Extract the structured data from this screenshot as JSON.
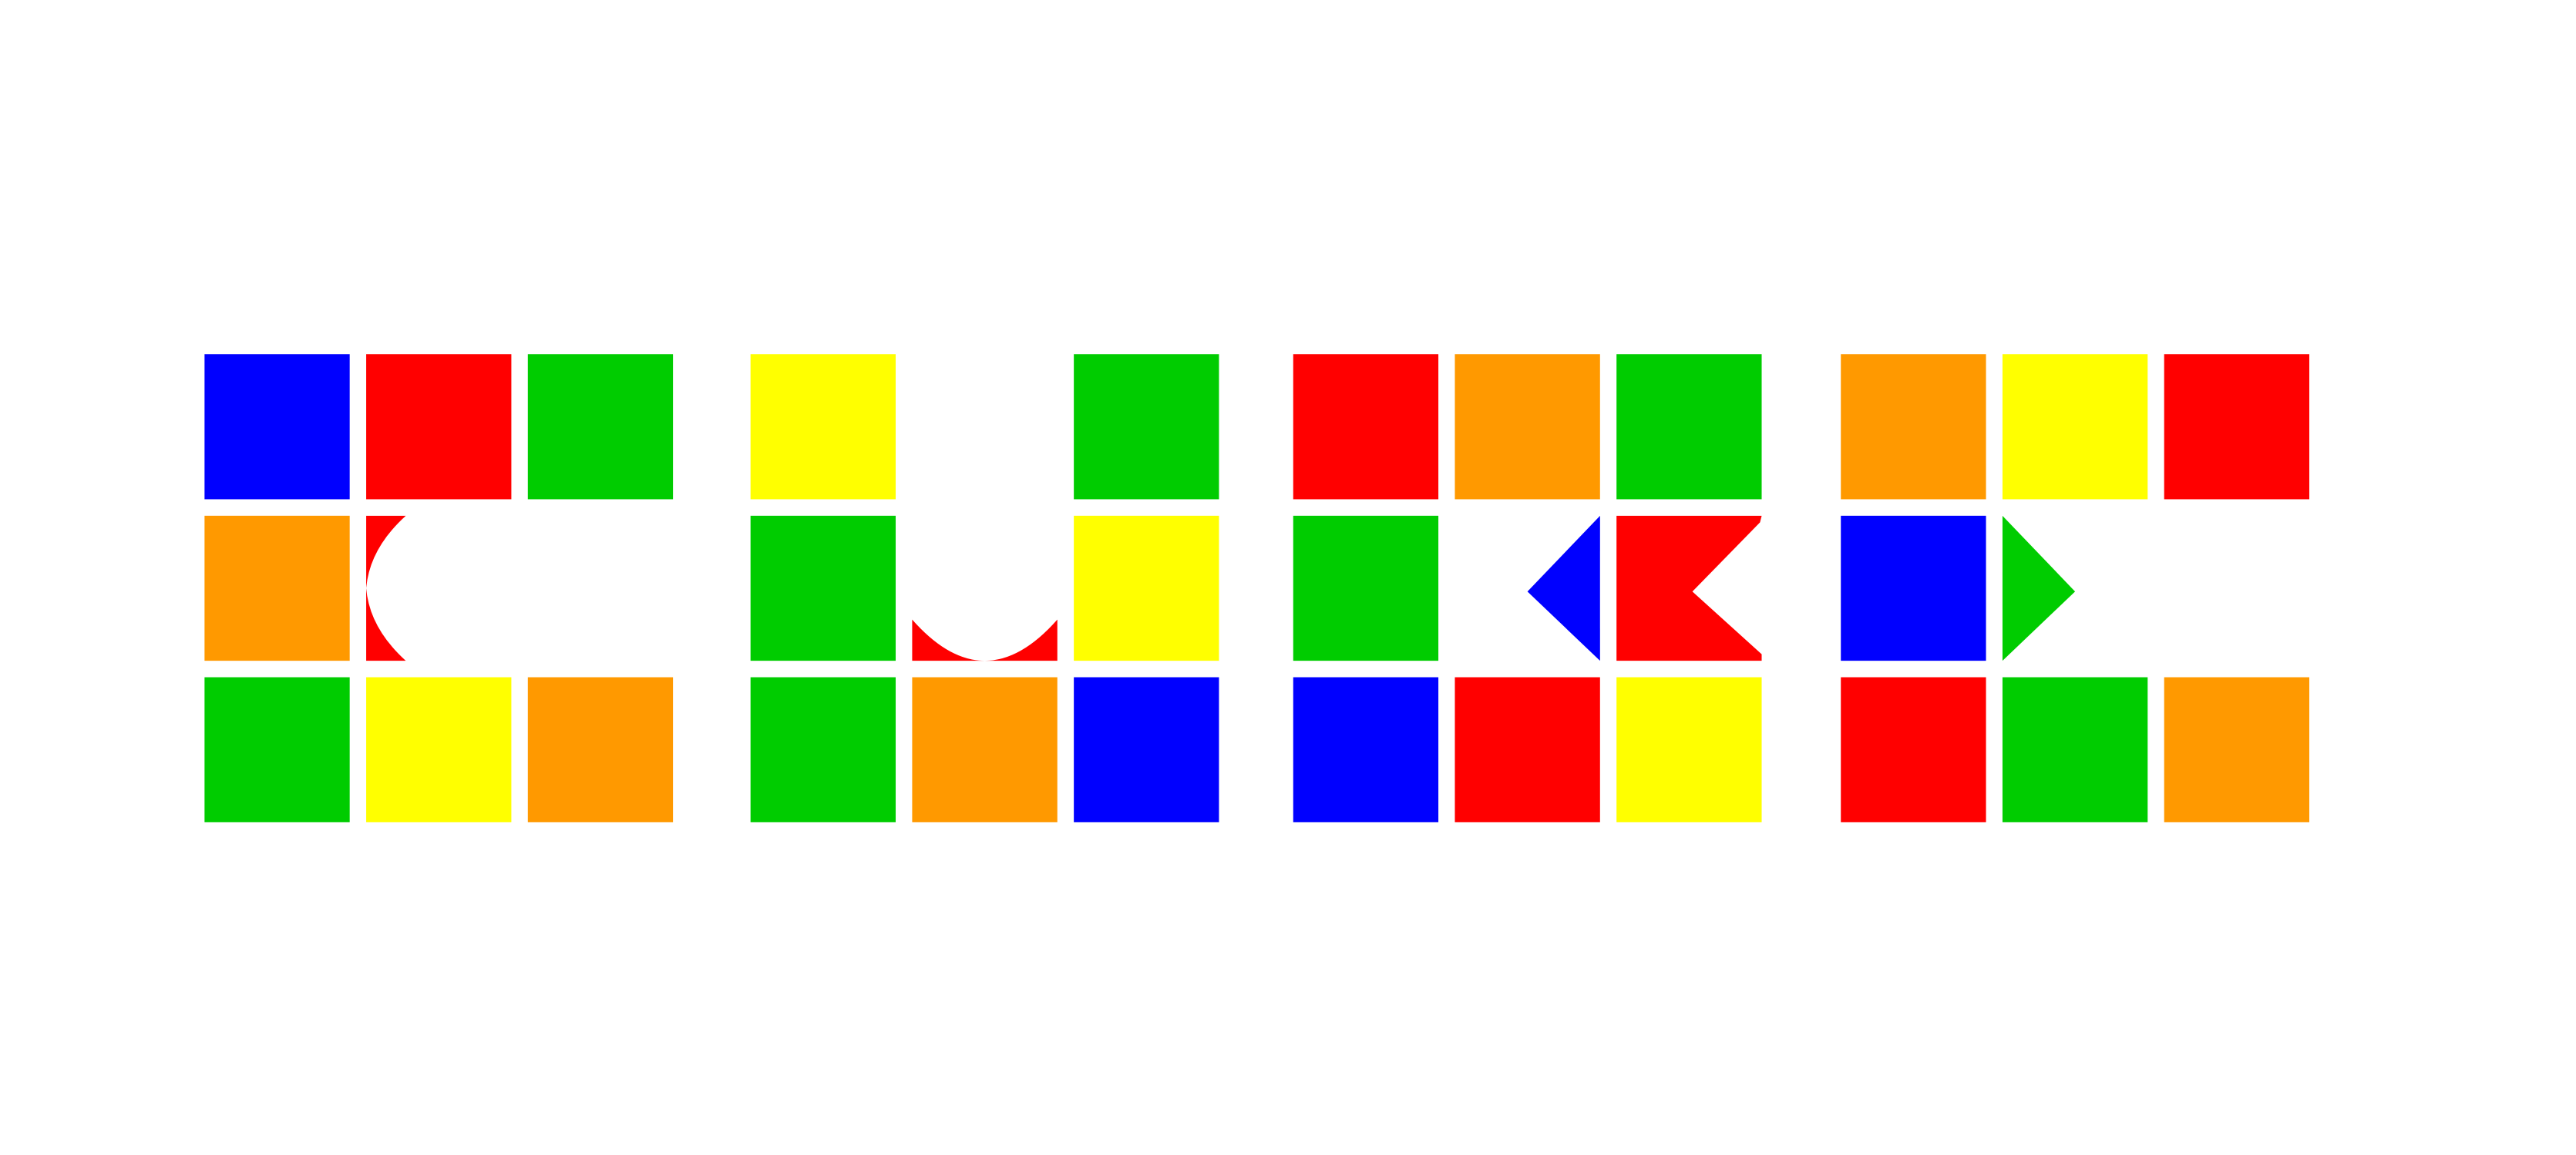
{
  "colors": {
    "blue": "#0000ff",
    "red": "#ff0000",
    "green": "#00cc00",
    "orange": "#ff9900",
    "yellow": "#ffff00",
    "white": "#ffffff"
  },
  "logo": {
    "word": "CUBE",
    "letters": [
      {
        "letter": "C",
        "tiles": [
          [
            "blue",
            "red",
            "green"
          ],
          [
            "orange",
            "red-c-curve",
            "empty"
          ],
          [
            "green",
            "yellow",
            "orange"
          ]
        ]
      },
      {
        "letter": "U",
        "tiles": [
          [
            "yellow",
            "empty",
            "green"
          ],
          [
            "green",
            "red-u-curve",
            "yellow"
          ],
          [
            "green",
            "orange",
            "blue"
          ]
        ]
      },
      {
        "letter": "B",
        "tiles": [
          [
            "red",
            "orange",
            "green"
          ],
          [
            "green",
            "blue-left-triangle",
            "red-b-notch"
          ],
          [
            "blue",
            "red",
            "yellow"
          ]
        ]
      },
      {
        "letter": "E",
        "tiles": [
          [
            "orange",
            "yellow",
            "red"
          ],
          [
            "blue",
            "green-right-triangle",
            "empty"
          ],
          [
            "red",
            "green",
            "orange"
          ]
        ]
      }
    ]
  }
}
